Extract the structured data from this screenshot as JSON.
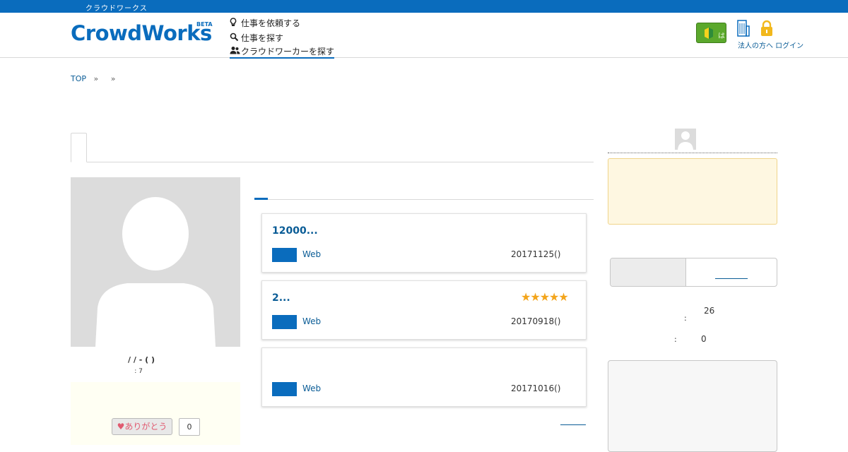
{
  "topbar": {
    "text": "クラウドワークス"
  },
  "header": {
    "logo": "CrowdWorks",
    "logo_badge": "BETA",
    "nav": [
      {
        "icon": "lightbulb-icon",
        "label": "仕事を依頼する"
      },
      {
        "icon": "search-icon",
        "label": "仕事を探す"
      },
      {
        "icon": "users-icon",
        "label": "クラウドワーカーを探す"
      }
    ],
    "beginner_label": "はじめての方",
    "links": "法人の方へ ログイン"
  },
  "breadcrumb": {
    "top": "TOP",
    "sep": "»"
  },
  "profile": {
    "meta": "/ / - ( )",
    "age": ": 7",
    "thanks_label": "ありがとう",
    "thanks_count": "0"
  },
  "jobs": [
    {
      "title": "12000...",
      "category": "Web",
      "date": "20171125()",
      "rating": ""
    },
    {
      "title": "2...",
      "category": "Web",
      "date": "20170918()",
      "rating": "★★★★★"
    },
    {
      "title": "",
      "category": "Web",
      "date": "20171016()",
      "rating": ""
    }
  ],
  "sidebar": {
    "stat1_colon": ":",
    "stat1_value": "26",
    "stat2_colon": ":",
    "stat2_value": "0"
  },
  "colors": {
    "brand": "#0a6cbd",
    "star": "#f3a51c",
    "notice_bg": "#fef7e1"
  }
}
